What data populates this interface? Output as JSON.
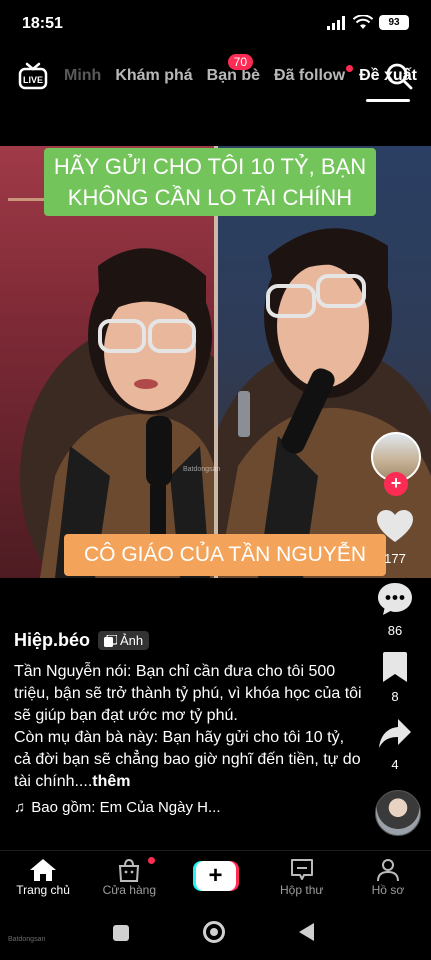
{
  "status_bar": {
    "time": "18:51",
    "battery": "93"
  },
  "top_nav": {
    "tabs": [
      {
        "label": "Minh"
      },
      {
        "label": "Khám phá"
      },
      {
        "label": "Bạn bè",
        "badge": "70"
      },
      {
        "label": "Đã follow"
      },
      {
        "label": "Đề xuất"
      }
    ]
  },
  "video": {
    "caption_top": "HÃY GỬI CHO TÔI 10 TỶ, BẠN KHÔNG CẦN LO TÀI CHÍNH",
    "caption_bottom": "CÔ GIÁO CỦA TẦN NGUYỄN",
    "watermark": "Batdongsan"
  },
  "actions": {
    "likes": "177",
    "comments": "86",
    "saves": "8",
    "shares": "4"
  },
  "post": {
    "author": "Hiệp.béo",
    "type_chip": "Ảnh",
    "description_lines": [
      "Tần Nguyễn nói: Bạn chỉ cần đưa cho tôi 500 triệu, bận sẽ trở thành tỷ phú, vì khóa học của tôi sẽ giúp bạn đạt ước mơ tỷ phú.",
      "Còn mụ đàn bà này: Bạn hãy gửi cho tôi 10 tỷ, cả đời bạn sẽ chẳng bao giờ nghĩ đến tiền, tự do tài chính...."
    ],
    "more_label": "thêm",
    "music": "Bao gồm: Em Của Ngày H..."
  },
  "tab_bar": {
    "home": "Trang chủ",
    "shop": "Cửa hàng",
    "inbox": "Hộp thư",
    "profile": "Hồ sơ"
  },
  "sys_nav": {
    "corner_mark": "Batdongsan"
  },
  "colors": {
    "accent": "#fe2c55",
    "caption_green": "#74c45c",
    "caption_orange": "#f3a45a"
  }
}
